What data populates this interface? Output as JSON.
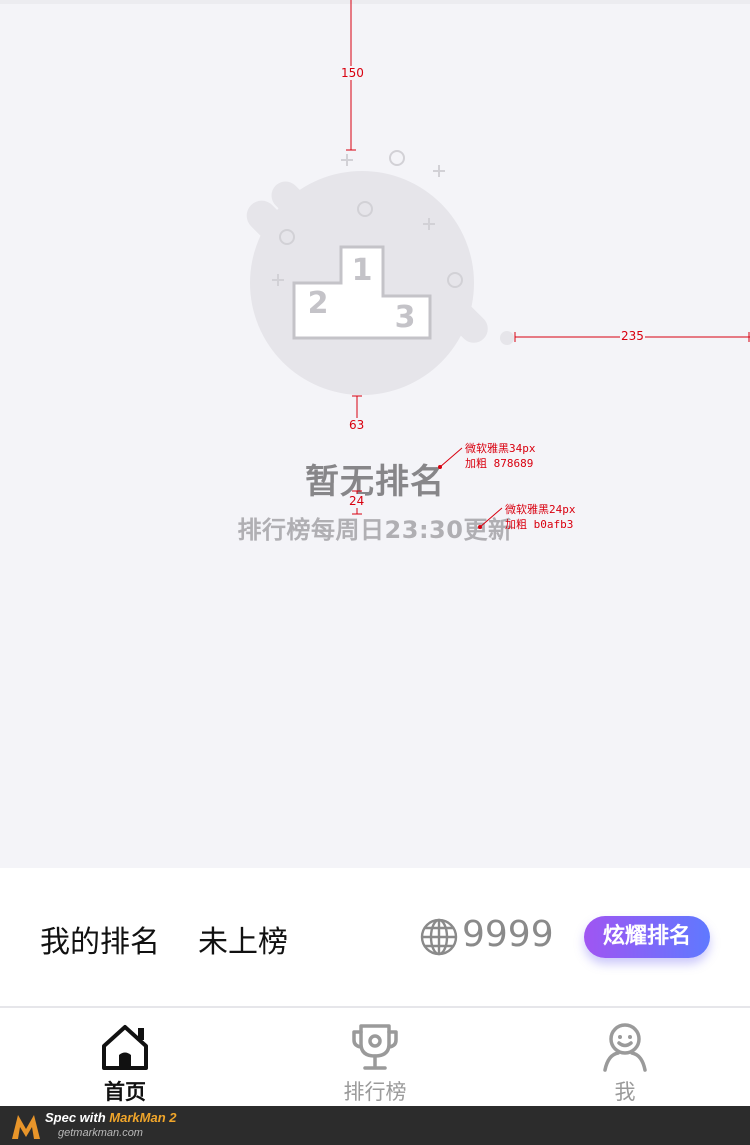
{
  "empty_state": {
    "illustration_icon": "podium-icon",
    "podium_numbers": [
      "1",
      "2",
      "3"
    ],
    "title": "暂无排名",
    "subtitle": "排行榜每周日23:30更新"
  },
  "spec_annotations": {
    "dim_top": "150",
    "dim_right": "235",
    "dim_gap1": "63",
    "dim_gap2": "24",
    "title_note": "微软雅黑34px\n加粗 878689",
    "subtitle_note": "微软雅黑24px\n加粗 b0afb3"
  },
  "my_rank": {
    "label": "我的排名",
    "status": "未上榜",
    "icon": "globe-icon",
    "count": "9999",
    "show_button": "炫耀排名"
  },
  "tabbar": {
    "tabs": [
      {
        "label": "首页",
        "icon": "home-icon",
        "active": true
      },
      {
        "label": "排行榜",
        "icon": "trophy-icon",
        "active": false
      },
      {
        "label": "我",
        "icon": "user-icon",
        "active": false
      }
    ]
  },
  "footer": {
    "title_prefix": "Spec with ",
    "brand": "MarkMan 2",
    "url": "getmarkman.com"
  },
  "colors": {
    "title": "#878689",
    "subtitle": "#b0afb3",
    "annotation": "#d9000f",
    "button_gradient_start": "#a055f2",
    "button_gradient_end": "#5f79ff"
  }
}
